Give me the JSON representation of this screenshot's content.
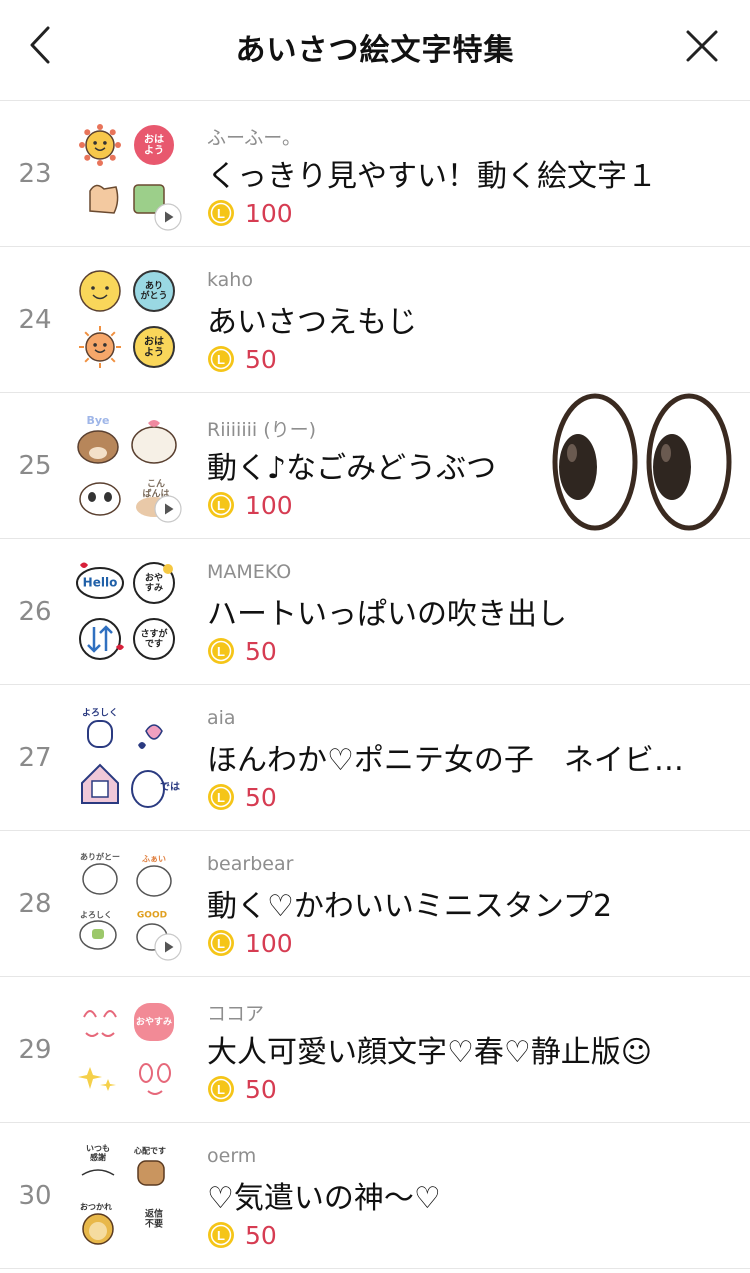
{
  "header": {
    "title": "あいさつ絵文字特集",
    "back_icon": "chevron-left-icon",
    "close_icon": "close-icon"
  },
  "items": [
    {
      "rank": "23",
      "author": "ふーふー。",
      "name": "くっきり見やすい！動く絵文字１",
      "price": "100",
      "animated": true
    },
    {
      "rank": "24",
      "author": "kaho",
      "name": "あいさつえもじ",
      "price": "50",
      "animated": false
    },
    {
      "rank": "25",
      "author": "Riiiiiii (りー)",
      "name": "動く♪なごみどうぶつ",
      "price": "100",
      "animated": true
    },
    {
      "rank": "26",
      "author": "MAMEKO",
      "name": "ハートいっぱいの吹き出し",
      "price": "50",
      "animated": false
    },
    {
      "rank": "27",
      "author": "aia",
      "name": "ほんわか♡ポニテ女の子　ネイビ…",
      "price": "50",
      "animated": false
    },
    {
      "rank": "28",
      "author": "bearbear",
      "name": "動く♡かわいいミニスタンプ2",
      "price": "100",
      "animated": true
    },
    {
      "rank": "29",
      "author": "ココア",
      "name": "大人可愛い顔文字♡春♡静止版☺",
      "price": "50",
      "animated": false
    },
    {
      "rank": "30",
      "author": "oerm",
      "name": "♡気遣いの神〜♡",
      "price": "50",
      "animated": false
    }
  ],
  "thumbs": [
    {
      "tl": "",
      "tr": "おは\nよう",
      "bl": "",
      "br": ""
    },
    {
      "tl": "",
      "tr": "あり\nがとう",
      "bl": "",
      "br": "おは\nよう"
    },
    {
      "tl": "Bye",
      "tr": "",
      "bl": "",
      "br": "こん\nばんは"
    },
    {
      "tl": "Hello",
      "tr": "おや\nすみ",
      "bl": "",
      "br": "さすが\nです"
    },
    {
      "tl": "よろしく",
      "tr": "",
      "bl": "",
      "br": "では"
    },
    {
      "tl": "ありがとー",
      "tr": "ふぁい",
      "bl": "よろしく",
      "br": "GOOD"
    },
    {
      "tl": "",
      "tr": "おやすみ",
      "bl": "",
      "br": ""
    },
    {
      "tl": "いつも\n感謝",
      "tr": "心配です",
      "bl": "おつかれ",
      "br": "返信\n不要"
    }
  ],
  "coin_letter": "L",
  "colors": {
    "price": "#d63c52",
    "coin": "#f5c518",
    "divider": "#e6e6e6"
  }
}
